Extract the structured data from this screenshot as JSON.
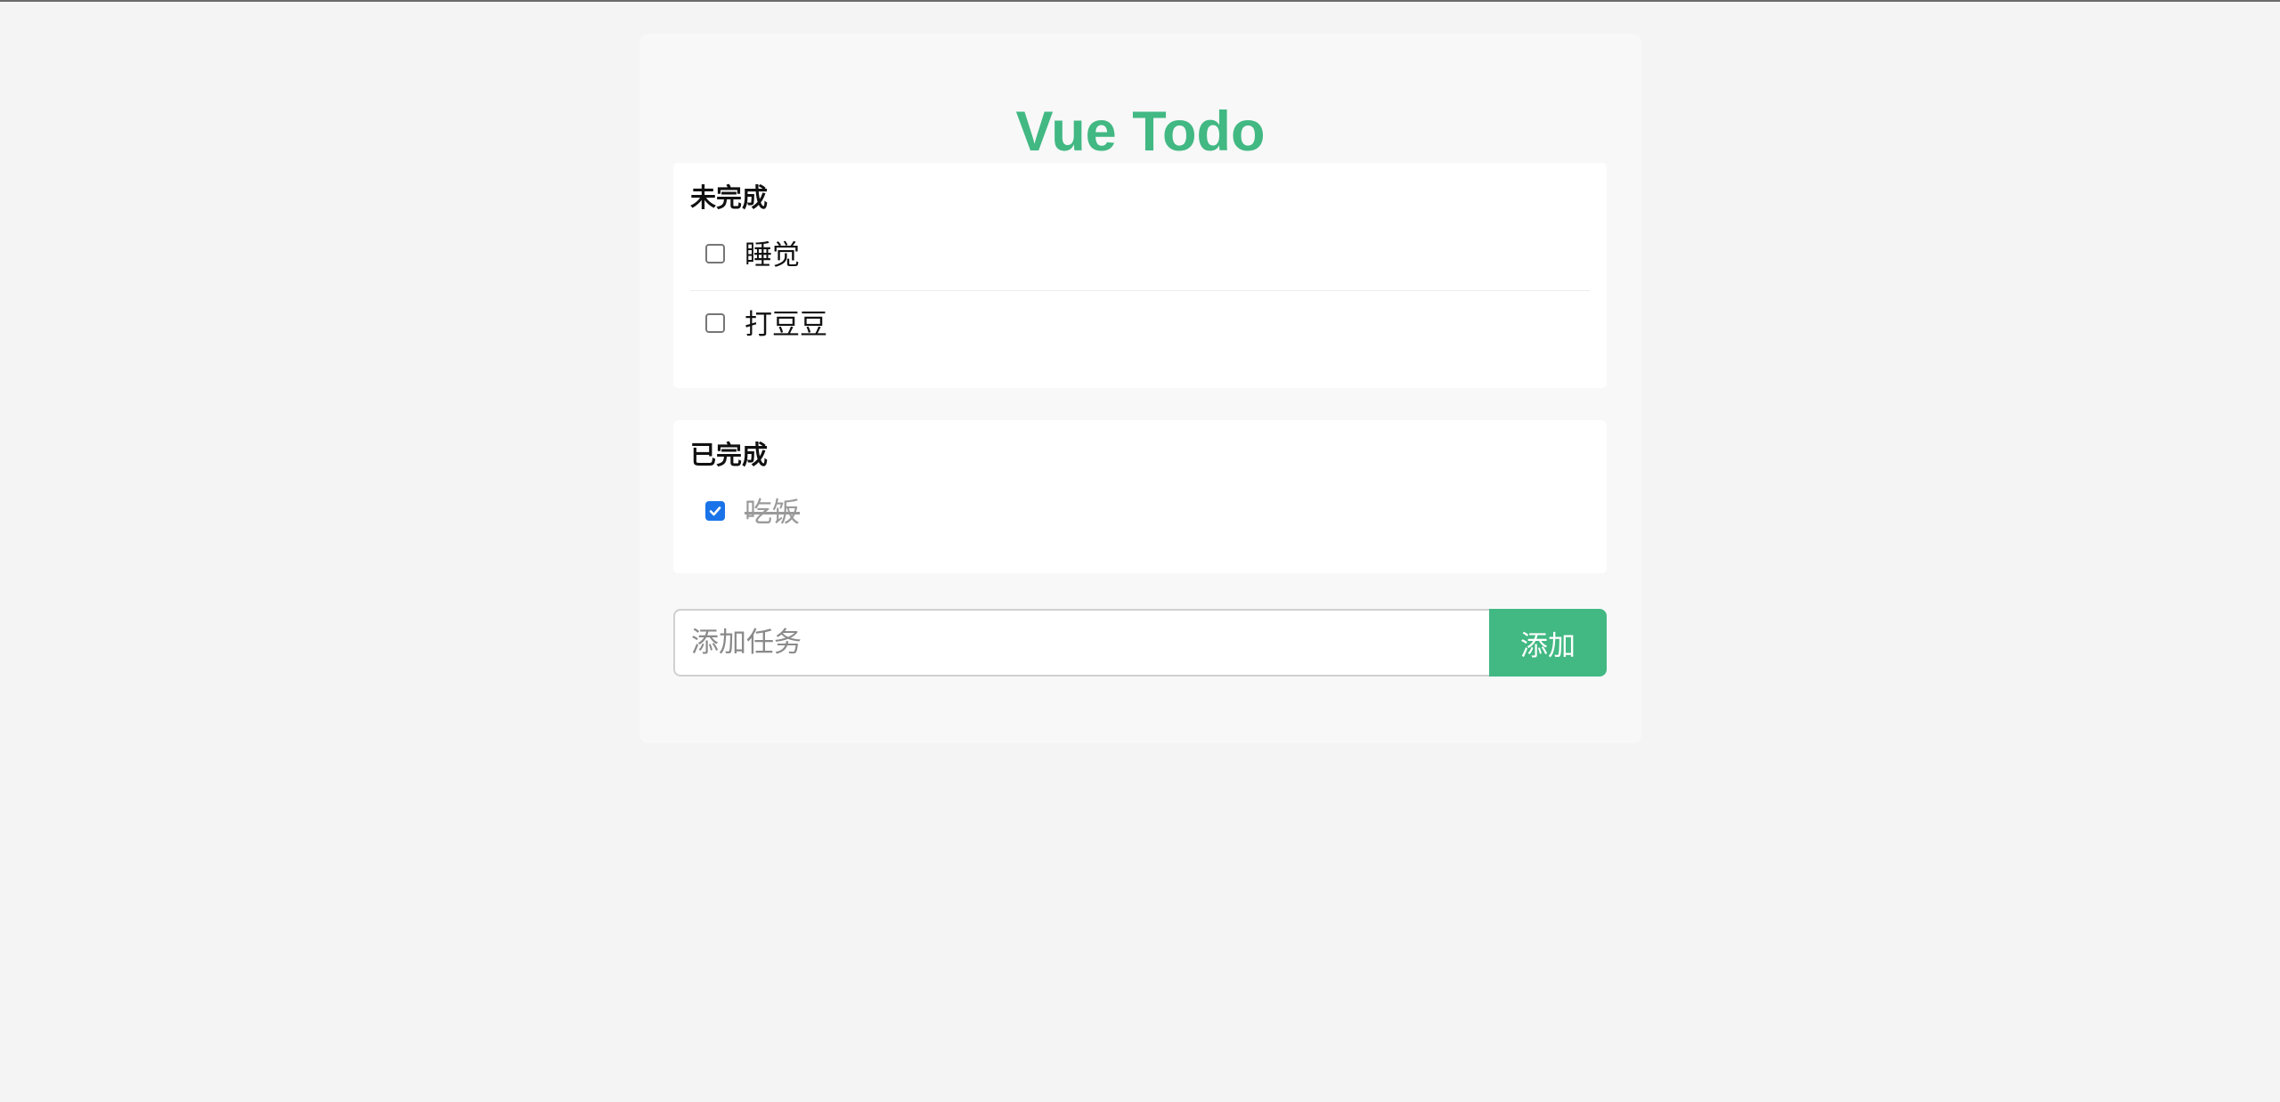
{
  "app": {
    "title": "Vue Todo",
    "accent_color": "#42b883"
  },
  "pending": {
    "heading": "未完成",
    "items": [
      {
        "label": "睡觉",
        "checked": false
      },
      {
        "label": "打豆豆",
        "checked": false
      }
    ]
  },
  "completed": {
    "heading": "已完成",
    "items": [
      {
        "label": "吃饭",
        "checked": true
      }
    ]
  },
  "add_form": {
    "input_value": "",
    "input_placeholder": "添加任务",
    "button_label": "添加"
  },
  "icons": {
    "checkbox_unchecked": "checkbox-empty-icon",
    "checkbox_checked": "checkbox-checked-icon"
  },
  "colors": {
    "page_background": "#f4f4f4",
    "card_background": "#f8f8f8",
    "done_text": "#9a9a9a",
    "checkbox_checked": "#1a73e8"
  }
}
